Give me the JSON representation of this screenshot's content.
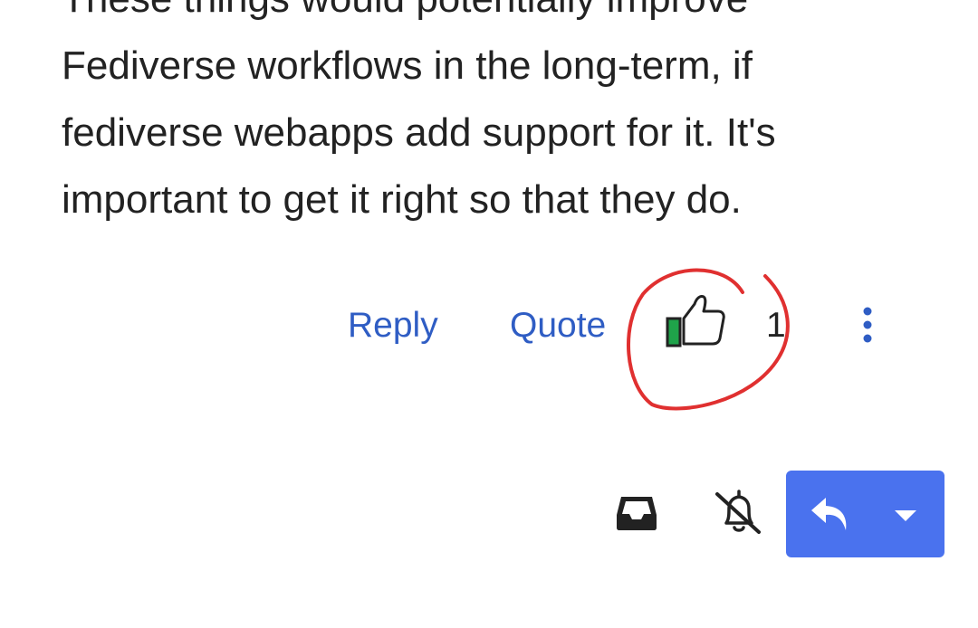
{
  "post": {
    "lines": [
      "These things would potentially improve",
      "Fediverse workflows in the long-term, if",
      "fediverse webapps add support for it. It's",
      "important to get it right so that they do."
    ]
  },
  "actions": {
    "reply_label": "Reply",
    "quote_label": "Quote",
    "like_count": "1",
    "like_icon": "thumbs-up-icon",
    "more_icon": "more-vertical-icon"
  },
  "footer": {
    "inbox_icon": "inbox-icon",
    "notifications_icon": "bell-off-icon",
    "reply_button_icon": "reply-arrow-icon",
    "dropdown_icon": "caret-down-icon"
  },
  "colors": {
    "text": "#222222",
    "link": "#2f5dc4",
    "like_accent": "#1fa34a",
    "annotation": "#e03030",
    "primary_button": "#4a72ee"
  }
}
